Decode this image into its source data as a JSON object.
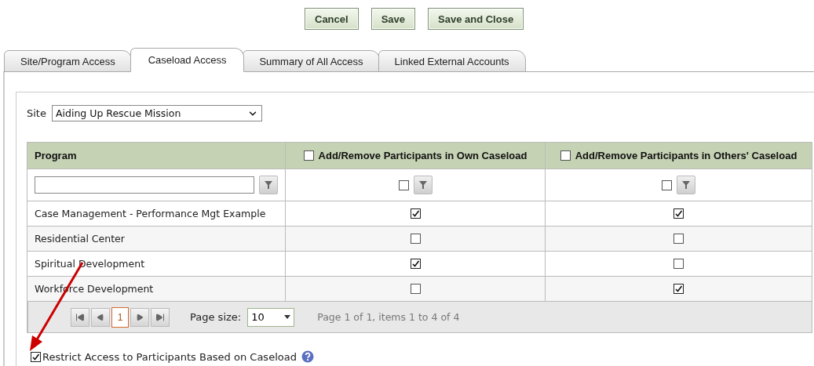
{
  "buttons": [
    "Cancel",
    "Save",
    "Save and Close"
  ],
  "tabs": [
    {
      "label": "Site/Program Access",
      "selected": false
    },
    {
      "label": "Caseload Access",
      "selected": true
    },
    {
      "label": "Summary of All Access",
      "selected": false
    },
    {
      "label": "Linked External Accounts",
      "selected": false
    }
  ],
  "site": {
    "label": "Site",
    "value": "Aiding Up Rescue Mission"
  },
  "table": {
    "columns": [
      {
        "label": "Program"
      },
      {
        "label": "Add/Remove Participants in Own Caseload",
        "checked": false,
        "filter_checked": false
      },
      {
        "label": "Add/Remove Participants in Others' Caseload",
        "checked": false,
        "filter_checked": false
      }
    ],
    "rows": [
      {
        "program": "Case Management - Performance Mgt Example",
        "own": true,
        "others": true
      },
      {
        "program": "Residential Center",
        "own": false,
        "others": false
      },
      {
        "program": "Spiritual Development",
        "own": true,
        "others": false
      },
      {
        "program": "Workforce Development",
        "own": false,
        "others": true
      }
    ],
    "pager": {
      "page": "1",
      "page_size_label": "Page size:",
      "page_size": "10",
      "summary": "Page 1 of 1, items 1 to 4 of 4"
    }
  },
  "restrict": {
    "label": "Restrict Access to Participants Based on Caseload",
    "checked": true
  }
}
